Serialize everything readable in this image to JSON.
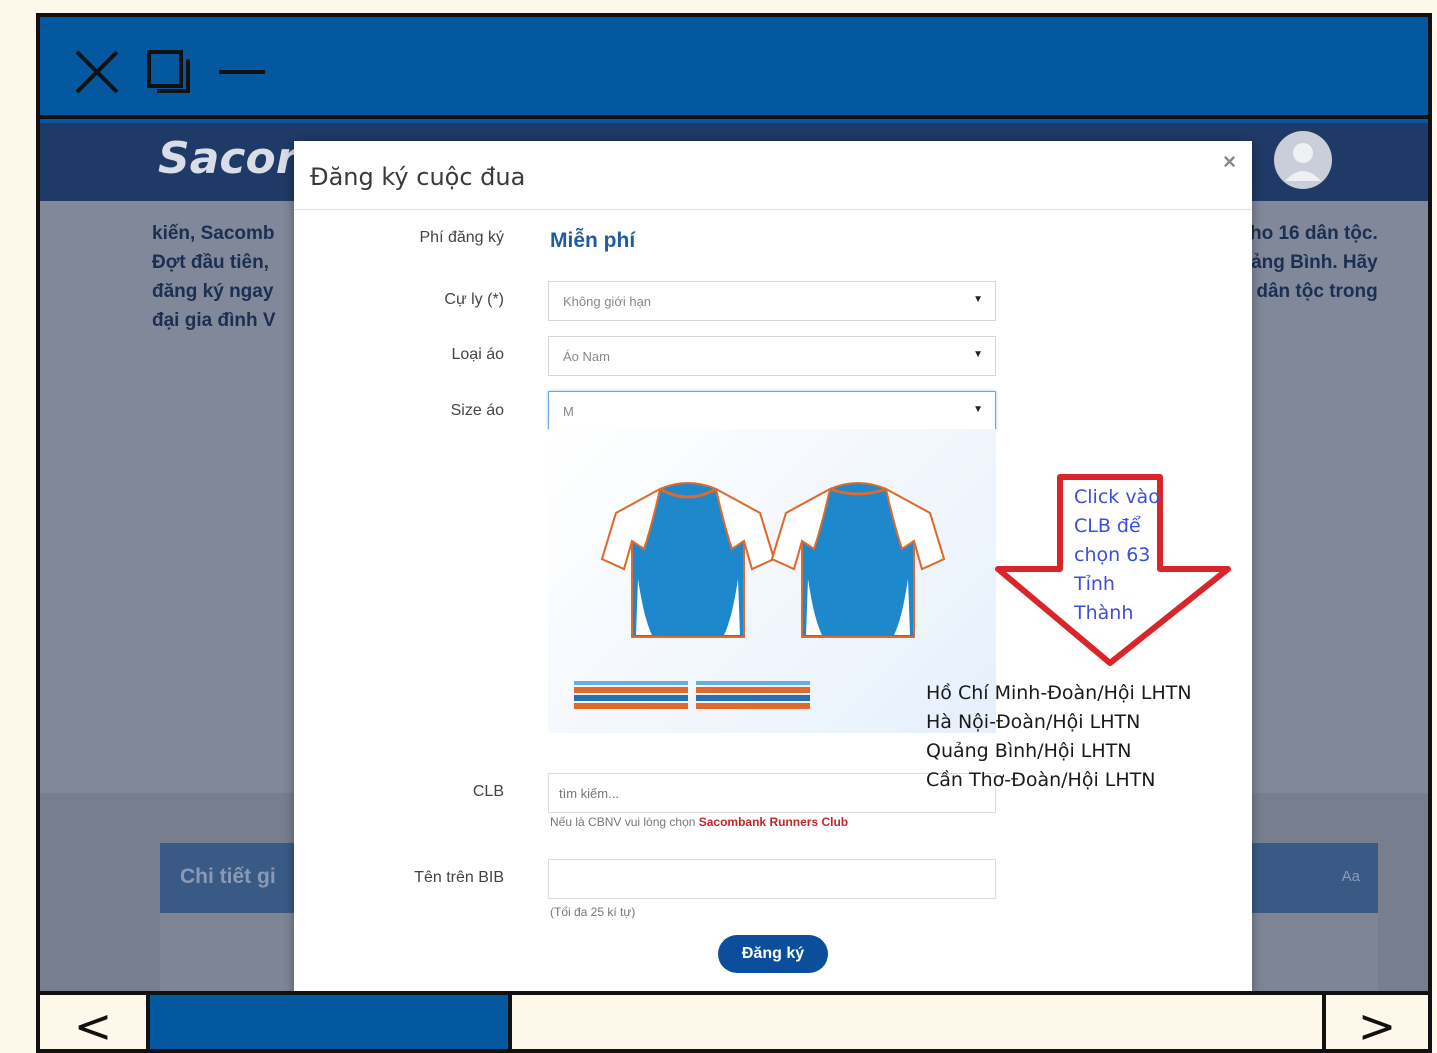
{
  "site": {
    "logo": "Sacor",
    "bg_left": [
      "kiến, Sacomb",
      "Đợt đầu tiên, ",
      "đăng ký ngay",
      "đại gia đình V"
    ],
    "bg_right": [
      "ho 16 dân tộc.",
      "ảng Bình. Hãy",
      "dân tộc trong"
    ],
    "detail_title": "Chi tiết gi",
    "detail_lang": "Aa"
  },
  "modal": {
    "title": "Đăng ký cuộc đua",
    "close": "×",
    "fee_label": "Phí đăng ký",
    "fee_value": "Miễn phí",
    "distance_label": "Cự ly (*)",
    "distance_value": "Không giới hạn",
    "shirt_type_label": "Loại áo",
    "shirt_type_value": "Áo Nam",
    "shirt_size_label": "Size áo",
    "shirt_size_value": "M",
    "clb_label": "CLB",
    "clb_placeholder": "tìm kiếm...",
    "clb_hint_prefix": "Nếu là CBNV vui lòng chọn ",
    "clb_hint_link": "Sacombank Runners Club",
    "bib_label": "Tên trên BIB",
    "bib_hint": "(Tối đa 25 kí tự)",
    "submit": "Đăng ký"
  },
  "annotation": {
    "arrow_text": [
      "Click vào",
      "CLB để",
      "chọn 63",
      "Tỉnh",
      "Thành"
    ],
    "clubs": [
      "Hồ Chí Minh-Đoàn/Hội LHTN",
      "Hà Nội-Đoàn/Hội LHTN",
      "Quảng Bình/Hội LHTN",
      "Cần Thơ-Đoàn/Hội LHTN"
    ],
    "arrow_color": "#d9252a"
  },
  "nav": {
    "prev": "<",
    "next": ">"
  },
  "colors": {
    "frame_blue": "#0358a0",
    "header_navy": "#1f3a66",
    "brand_blue": "#1f5c9e"
  }
}
